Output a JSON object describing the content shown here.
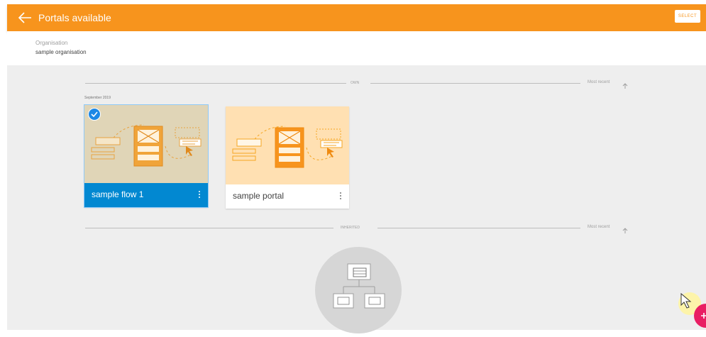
{
  "appbar": {
    "title": "Portals available",
    "select_label": "SELECT",
    "color": "#f7941d"
  },
  "organisation": {
    "label": "Organisation",
    "value": "sample organisation"
  },
  "sections": {
    "own": {
      "label": "OWN",
      "sort_label": "Most recent"
    },
    "inherited": {
      "label": "INHERITED",
      "sort_label": "Most recent"
    }
  },
  "group_date": "September 2019",
  "cards": [
    {
      "title": "sample flow 1",
      "selected": true,
      "footer_color": "#0288d1",
      "thumb_color": "#e0d5b7"
    },
    {
      "title": "sample portal",
      "selected": false,
      "footer_color": "#ffffff",
      "thumb_color": "#ffe0b2"
    }
  ],
  "icons": {
    "back": "arrow-left-icon",
    "sort": "arrow-up-icon",
    "check": "check-circle-icon",
    "menu": "more-vert-icon",
    "fab": "plus-icon"
  }
}
